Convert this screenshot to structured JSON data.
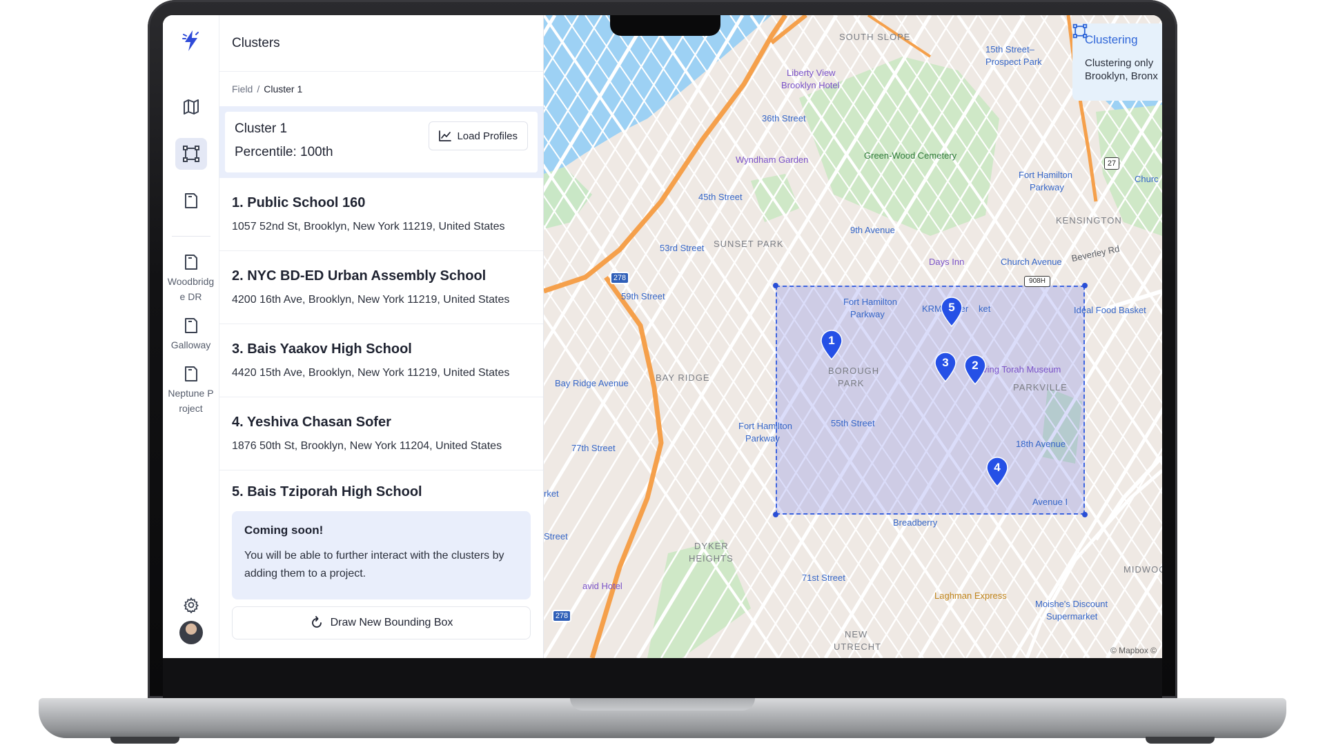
{
  "app": {
    "logo_icon": "lightning-logo-icon",
    "accent": "#3b63e0"
  },
  "rail": {
    "projects": [
      {
        "label": "Woodbridge DR",
        "icon": "folder-icon"
      },
      {
        "label": "Galloway",
        "icon": "folder-icon"
      },
      {
        "label": "Neptune Project",
        "icon": "folder-icon"
      }
    ]
  },
  "panel": {
    "title": "Clusters",
    "breadcrumb": {
      "root": "Field",
      "separator": "/",
      "current": "Cluster 1"
    },
    "cluster": {
      "title": "Cluster 1",
      "percentile": "Percentile: 100th",
      "load_label": "Load Profiles"
    },
    "schools": [
      {
        "name": "1. Public School 160",
        "address": "1057 52nd St, Brooklyn, New York 11219, United States"
      },
      {
        "name": "2. NYC BD-ED Urban Assembly School",
        "address": "4200 16th Ave, Brooklyn, New York 11219, United States"
      },
      {
        "name": "3. Bais Yaakov High School",
        "address": "4420 15th Ave, Brooklyn, New York 11219, United States"
      },
      {
        "name": "4. Yeshiva Chasan Sofer",
        "address": "1876 50th St, Brooklyn, New York 11204, United States"
      },
      {
        "name": "5. Bais Tziporah High School",
        "address": ""
      }
    ],
    "notice": {
      "title": "Coming soon!",
      "body": "You will be able to further interact with the clusters by adding them to a project."
    },
    "draw_label": "Draw New Bounding Box"
  },
  "map": {
    "clustering_card": {
      "title": "Clustering",
      "line1": "Clustering only",
      "line2": "Brooklyn, Bronx"
    },
    "attribution": "© Mapbox ©",
    "pins": [
      "1",
      "2",
      "3",
      "4",
      "5"
    ],
    "labels": {
      "south_slope": "SOUTH SLOPE",
      "liberty_view": "Liberty View",
      "brooklyn_hotel": "Brooklyn Hotel",
      "st_36": "36th Street",
      "wyndham": "Wyndham Garden",
      "green_wood": "Green-Wood Cemetery",
      "st_45": "45th Street",
      "st_53": "53rd Street",
      "sunset_park": "SUNSET PARK",
      "ave_9": "9th Avenue",
      "days_inn": "Days Inn",
      "church_ave": "Church Avenue",
      "kensington": "KENSINGTON",
      "beverley_rd": "Beverley Rd",
      "fhp_15": "15th Street–",
      "prospect_park": "Prospect Park",
      "fort_hamilton_pkwy_ne": "Fort Hamilton",
      "parkway_ne": "Parkway",
      "fhp_a": "Fort Hamilton",
      "fhp_a2": "Parkway",
      "krm": "KRM Super",
      "krm2": "ket",
      "ideal": "Ideal Food Basket",
      "st_59": "59th Street",
      "bay_ridge_ave": "Bay Ridge Avenue",
      "bay_ridge": "BAY RIDGE",
      "borough": "BOROUGH",
      "park": "PARK",
      "living_torah": "Living Torah Museum",
      "parkville": "PARKVILLE",
      "fhp_b": "Fort Hamilton",
      "fhp_b2": "Parkway",
      "st_55": "55th Street",
      "ave_18": "18th Avenue",
      "ave_i": "Avenue I",
      "st_77": "77th Street",
      "breadberry": "Breadberry",
      "dyker": "DYKER",
      "heights": "HEIGHTS",
      "st_71": "71st Street",
      "laghman": "Laghman Express",
      "moishe": "Moishe's Discount",
      "supermarket": "Supermarket",
      "new_utrecht": "NEW",
      "utrecht": "UTRECHT",
      "midwood": "MIDWOOD",
      "avid_hotel": "avid Hotel",
      "street_left": "Street",
      "market_left": "rket",
      "church_right": "Churc",
      "route_278a": "278",
      "route_278b": "278",
      "route_27": "27",
      "route_908h": "908H"
    }
  }
}
